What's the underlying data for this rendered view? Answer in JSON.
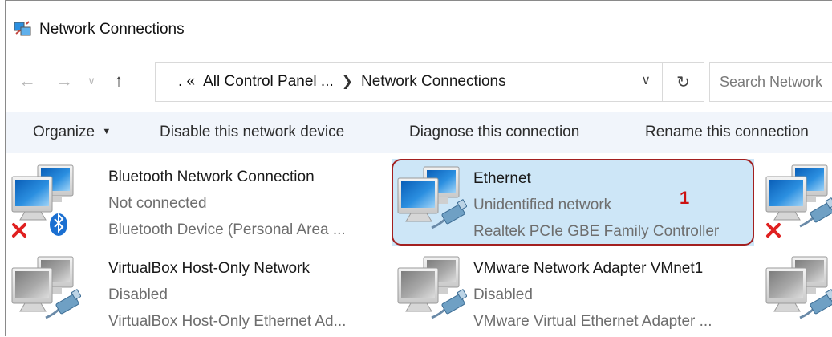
{
  "window": {
    "title": "Network Connections"
  },
  "address": {
    "prefix": ". «",
    "crumbs": [
      "All Control Panel ...",
      "Network Connections"
    ],
    "search_placeholder": "Search Network"
  },
  "toolbar": {
    "organize": "Organize",
    "disable": "Disable this network device",
    "diagnose": "Diagnose this connection",
    "rename": "Rename this connection"
  },
  "connections": [
    {
      "name": "Bluetooth Network Connection",
      "status": "Not connected",
      "device": "Bluetooth Device (Personal Area ...",
      "icon": "bluetooth-network-icon",
      "state": "disconnected"
    },
    {
      "name": "Ethernet",
      "status": "Unidentified network",
      "device": "Realtek PCIe GBE Family Controller",
      "icon": "ethernet-network-icon",
      "state": "selected"
    },
    {
      "name": "VirtualBox Host-Only Network",
      "status": "Disabled",
      "device": "VirtualBox Host-Only Ethernet Ad...",
      "icon": "ethernet-network-icon",
      "state": "disabled"
    },
    {
      "name": "VMware Network Adapter VMnet1",
      "status": "Disabled",
      "device": "VMware Virtual Ethernet Adapter ...",
      "icon": "ethernet-network-icon",
      "state": "disabled"
    }
  ],
  "annotation": {
    "callout_number": "1",
    "color": "#a32020"
  },
  "colors": {
    "selection": "#cde6f7",
    "toolbar_bg": "#f1f5fb",
    "error_x": "#e02020"
  }
}
